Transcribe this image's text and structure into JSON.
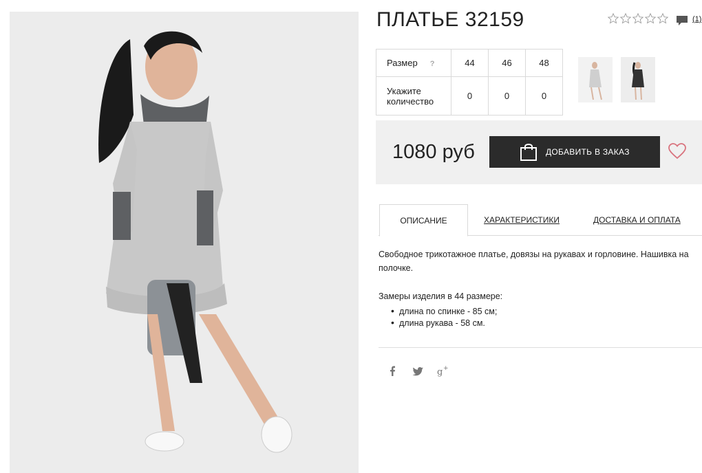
{
  "product": {
    "title": "ПЛАТЬЕ 32159",
    "rating_stars": 0,
    "comment_count": "(1)",
    "price": "1080 руб",
    "add_to_order_label": "ДОБАВИТЬ В ЗАКАЗ"
  },
  "size_table": {
    "size_label": "Размер",
    "help_mark": "?",
    "sizes": [
      "44",
      "46",
      "48"
    ],
    "quantity_label_line1": "Укажите",
    "quantity_label_line2": "количество",
    "quantities": [
      "0",
      "0",
      "0"
    ]
  },
  "tabs": [
    {
      "label": "ОПИСАНИЕ"
    },
    {
      "label": "ХАРАКТЕРИСТИКИ"
    },
    {
      "label": "ДОСТАВКА И ОПЛАТА"
    }
  ],
  "description": {
    "text": "Свободное трикотажное платье, довязы на рукавах и горловине. Нашивка на полочке.",
    "measurements_title": "Замеры изделия в 44 размере:",
    "measurements": [
      "длина по спинке - 85 см;",
      "длина рукава - 58 см."
    ]
  },
  "icons": {
    "star": "star-outline-icon",
    "comment": "comment-icon",
    "bag": "shopping-bag-icon",
    "heart": "heart-icon",
    "facebook": "facebook-icon",
    "twitter": "twitter-icon",
    "google_plus": "google-plus-icon"
  },
  "colors": {
    "button_bg": "#2b2b2b",
    "price_box_bg": "#f0f0f0",
    "heart": "#d9747f"
  }
}
